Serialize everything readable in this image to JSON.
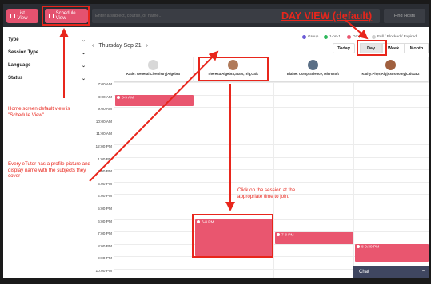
{
  "toolbar": {
    "list_view_label": "List View",
    "schedule_view_label": "Schedule View",
    "search_placeholder": "Enter a subject, course, or name...",
    "find_hosts_label": "Find Hosts"
  },
  "filters": [
    {
      "label": "Type"
    },
    {
      "label": "Session Type"
    },
    {
      "label": "Language"
    },
    {
      "label": "Status"
    }
  ],
  "legend": [
    {
      "label": "Group",
      "color": "#6b5bd6"
    },
    {
      "label": "1-on-1",
      "color": "#2eb85c"
    },
    {
      "label": "Drop-in",
      "color": "#e9566f"
    },
    {
      "label": "Full / Blocked / Expired",
      "color": "#cfcfcf"
    }
  ],
  "calendar": {
    "date": "Thursday Sep 21",
    "prev_icon": "chevron-left-icon",
    "next_icon": "chevron-right-icon",
    "today_label": "Today",
    "views": [
      "Day",
      "Week",
      "Month"
    ],
    "selected_view": "Day",
    "tutors": [
      "Katie: General Chemistry|Algebra",
      "Theresa:Algebra,Stats,Trig,Calc",
      "Elaine: Comp Science, Microsoft",
      "Kathy:Phys|Alg|Astronomy|Calc1&2"
    ],
    "times": [
      "7:00 AM",
      "8:00 AM",
      "9:00 AM",
      "10:00 AM",
      "11:00 AM",
      "12:00 PM",
      "1:00 PM",
      "2:00 PM",
      "3:00 PM",
      "4:00 PM",
      "5:00 PM",
      "6:00 PM",
      "7:00 PM",
      "8:00 PM",
      "9:00 PM",
      "10:00 PM"
    ],
    "events": [
      {
        "label": "8-9 AM"
      },
      {
        "label": "6-8 PM"
      },
      {
        "label": "7-8 PM"
      },
      {
        "label": "8-9:30 PM"
      }
    ]
  },
  "chat": {
    "label": "Chat",
    "icon": "chevron-up-icon"
  },
  "annotations": {
    "day_view": "DAY VIEW (default)",
    "home_default": "Home screen default view is \"Schedule View\"",
    "profile_note": "Every eTutor has a profile picture and display name with the subjects they cover",
    "click_session": "Click on the session at the appropriate time to join.",
    "color": "#e8261c"
  }
}
